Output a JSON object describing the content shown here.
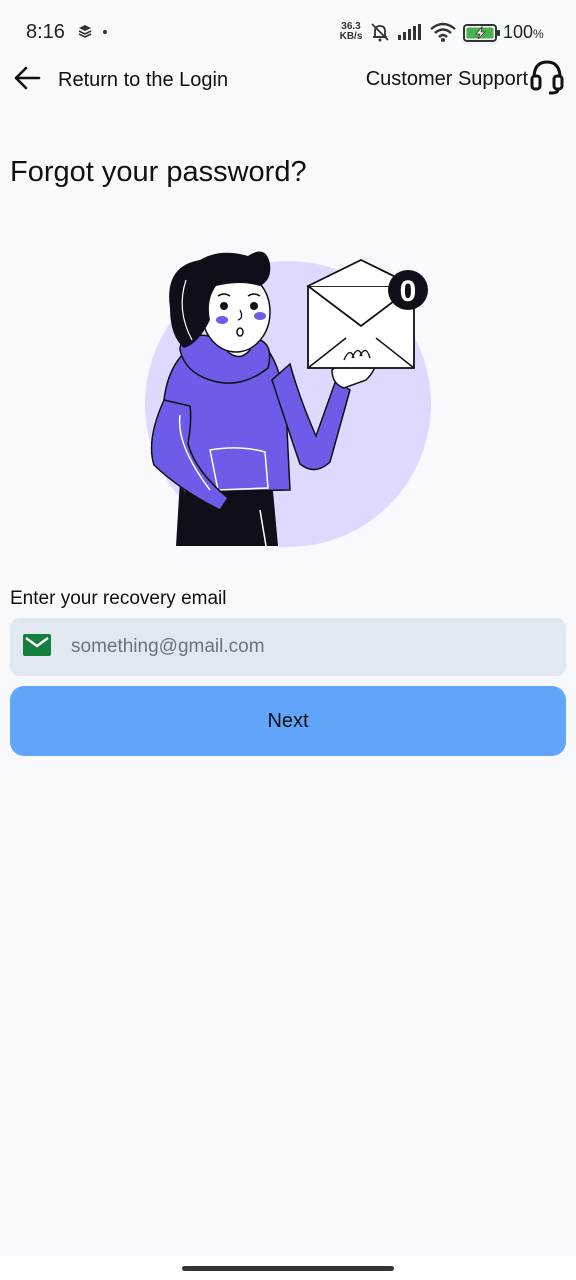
{
  "status_bar": {
    "time": "8:16",
    "net_speed_value": "36.3",
    "net_speed_unit": "KB/s",
    "battery_percent": "100",
    "battery_percent_sign": "%",
    "battery_color": "#4caf50"
  },
  "nav": {
    "back_label": "Return to the Login",
    "support_label": "Customer Support"
  },
  "page": {
    "title": "Forgot your password?"
  },
  "illustration": {
    "badge_count": "0",
    "accent_color": "#6c5ce7",
    "circle_color": "#dcdbff"
  },
  "form": {
    "email_label": "Enter your recovery email",
    "email_placeholder": "something@gmail.com",
    "email_value": "",
    "next_label": "Next"
  },
  "colors": {
    "primary_button": "#60a5fa",
    "input_background": "#e2e8f0",
    "mail_icon": "#15803d",
    "page_background": "#f7f9fc"
  }
}
